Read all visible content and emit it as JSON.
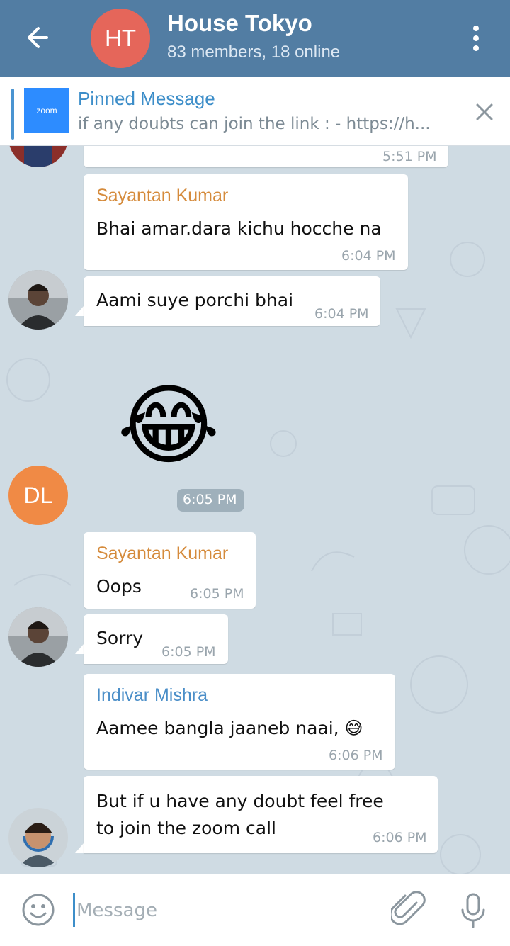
{
  "header": {
    "avatar_initials": "HT",
    "title": "House Tokyo",
    "subtitle": "83 members, 18 online"
  },
  "pinned": {
    "thumb_label": "zoom",
    "title": "Pinned Message",
    "text": "if any doubts can join the link : - https://h..."
  },
  "messages": {
    "m0": {
      "time": "5:51 PM"
    },
    "m1": {
      "sender": "Sayantan Kumar",
      "text": "Bhai amar.dara kichu hocche na",
      "time": "6:04 PM"
    },
    "m2": {
      "text": "Aami suye porchi bhai",
      "time": "6:04 PM"
    },
    "m3": {
      "avatar_initials": "DL",
      "sticker": "😂",
      "time": "6:05 PM"
    },
    "m4": {
      "sender": "Sayantan Kumar",
      "text": "Oops",
      "time": "6:05 PM"
    },
    "m5": {
      "text": "Sorry",
      "time": "6:05 PM"
    },
    "m6": {
      "sender": "Indivar Mishra",
      "text": "Aamee bangla jaaneb naai, 😅",
      "time": "6:06 PM"
    },
    "m7": {
      "line1": "But if u have any doubt feel free",
      "line2": "to join the zoom call",
      "time": "6:06 PM"
    }
  },
  "input": {
    "placeholder": "Message"
  },
  "colors": {
    "header": "#527da3",
    "chat_bg": "#cfdbe3",
    "sender_orange": "#d58b3c",
    "sender_blue": "#4a8ec8",
    "dl_avatar": "#f08a45",
    "ht_avatar": "#e5665a"
  }
}
